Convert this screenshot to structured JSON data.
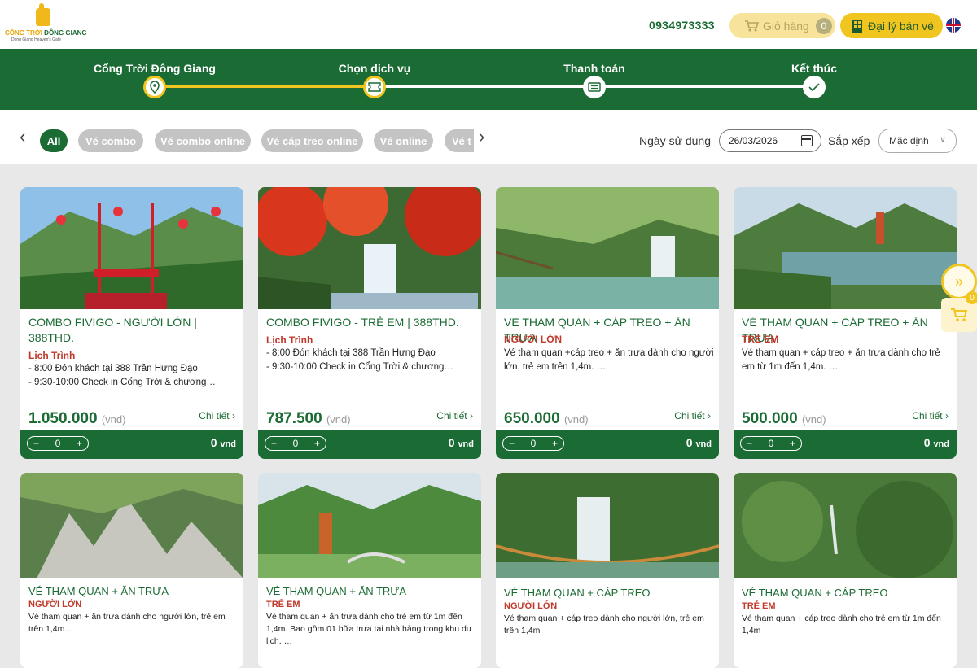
{
  "header": {
    "logo_text_1": "CỔNG TRỜI",
    "logo_text_2": "ĐÔNG GIANG",
    "logo_sub": "Dong Giang Heaven's Gate",
    "phone": "0934973333",
    "cart_label": "Giỏ hàng",
    "cart_count": "0",
    "agent_label": "Đại lý bán vé",
    "language_icon": "uk-flag-icon"
  },
  "steps": [
    {
      "label": "Cổng Trời Đông Giang",
      "icon": "map-pin-icon",
      "active": true
    },
    {
      "label": "Chọn dịch vụ",
      "icon": "ticket-icon",
      "active": true
    },
    {
      "label": "Thanh toán",
      "icon": "payment-icon",
      "active": false
    },
    {
      "label": "Kết thúc",
      "icon": "check-icon",
      "active": false
    }
  ],
  "filters": {
    "chips": [
      "All",
      "Vé combo",
      "Vé combo online",
      "Vé cáp treo online",
      "Vé online",
      "Vé t"
    ],
    "active": "All",
    "date_label": "Ngày sử dụng",
    "date_value": "26/03/2026",
    "sort_label": "Sắp xếp",
    "sort_value": "Mặc định"
  },
  "products": [
    {
      "title": "COMBO FIVIGO - NGƯỜI LỚN | 388THD.",
      "sub": "Lịch Trình",
      "desc": "- 8:00 Đón khách tại 388 Trần Hưng Đạo\n- 9:30-10:00 Check in Cổng Trời & chương…",
      "price": "1.050.000",
      "unit": "(vnd)",
      "detail": "Chi tiết",
      "qty": "0",
      "total": "0",
      "total_unit": "vnd"
    },
    {
      "title": "COMBO FIVIGO - TRẺ EM | 388THD.",
      "sub": "Lịch Trình",
      "desc": "- 8:00 Đón khách tại 388 Trần Hưng Đạo\n- 9:30-10:00 Check in Cổng Trời & chương…",
      "price": "787.500",
      "unit": "(vnd)",
      "detail": "Chi tiết",
      "qty": "0",
      "total": "0",
      "total_unit": "vnd"
    },
    {
      "title": "VÉ THAM QUAN + CÁP TREO + ĂN TRƯA",
      "sub": "NGƯỜI LỚN",
      "desc": "Vé tham quan +cáp treo + ăn trưa dành cho người lớn, trẻ em trên 1,4m. …",
      "price": "650.000",
      "unit": "(vnd)",
      "detail": "Chi tiết",
      "qty": "0",
      "total": "0",
      "total_unit": "vnd"
    },
    {
      "title": "VÉ THAM QUAN + CÁP TREO + ĂN TRƯA",
      "sub": "TRẺ EM",
      "desc": "Vé tham quan + cáp treo + ăn trưa dành cho trẻ em từ 1m đến 1,4m. …",
      "price": "500.000",
      "unit": "(vnd)",
      "detail": "Chi tiết",
      "qty": "0",
      "total": "0",
      "total_unit": "vnd"
    },
    {
      "title": "VÉ THAM QUAN + ĂN TRƯA",
      "sub": "NGƯỜI LỚN",
      "desc": "Vé tham quan + ăn trưa dành cho người lớn, trẻ em trên 1,4m…"
    },
    {
      "title": "VÉ THAM QUAN + ĂN TRƯA",
      "sub": "TRẺ EM",
      "desc": "Vé tham quan + ăn trưa dành cho trẻ em từ 1m đến 1,4m. Bao gồm 01 bữa trưa tại nhà hàng trong khu du lịch. …"
    },
    {
      "title": "VÉ THAM QUAN + CÁP TREO",
      "sub": "NGƯỜI LỚN",
      "desc": "Vé tham quan + cáp treo dành cho người lớn, trẻ em trên 1,4m"
    },
    {
      "title": "VÉ THAM QUAN + CÁP TREO",
      "sub": "TRẺ EM",
      "desc": "Vé tham quan + cáp treo dành cho trẻ em từ 1m đến 1,4m"
    }
  ],
  "floating": {
    "scroll_icon": "double-chevron-down-icon",
    "cart_icon": "cart-icon",
    "cart_count": "0"
  },
  "colors": {
    "brand_green": "#1b6b34",
    "accent_yellow": "#f1c51f",
    "label_red": "#c0392b"
  }
}
